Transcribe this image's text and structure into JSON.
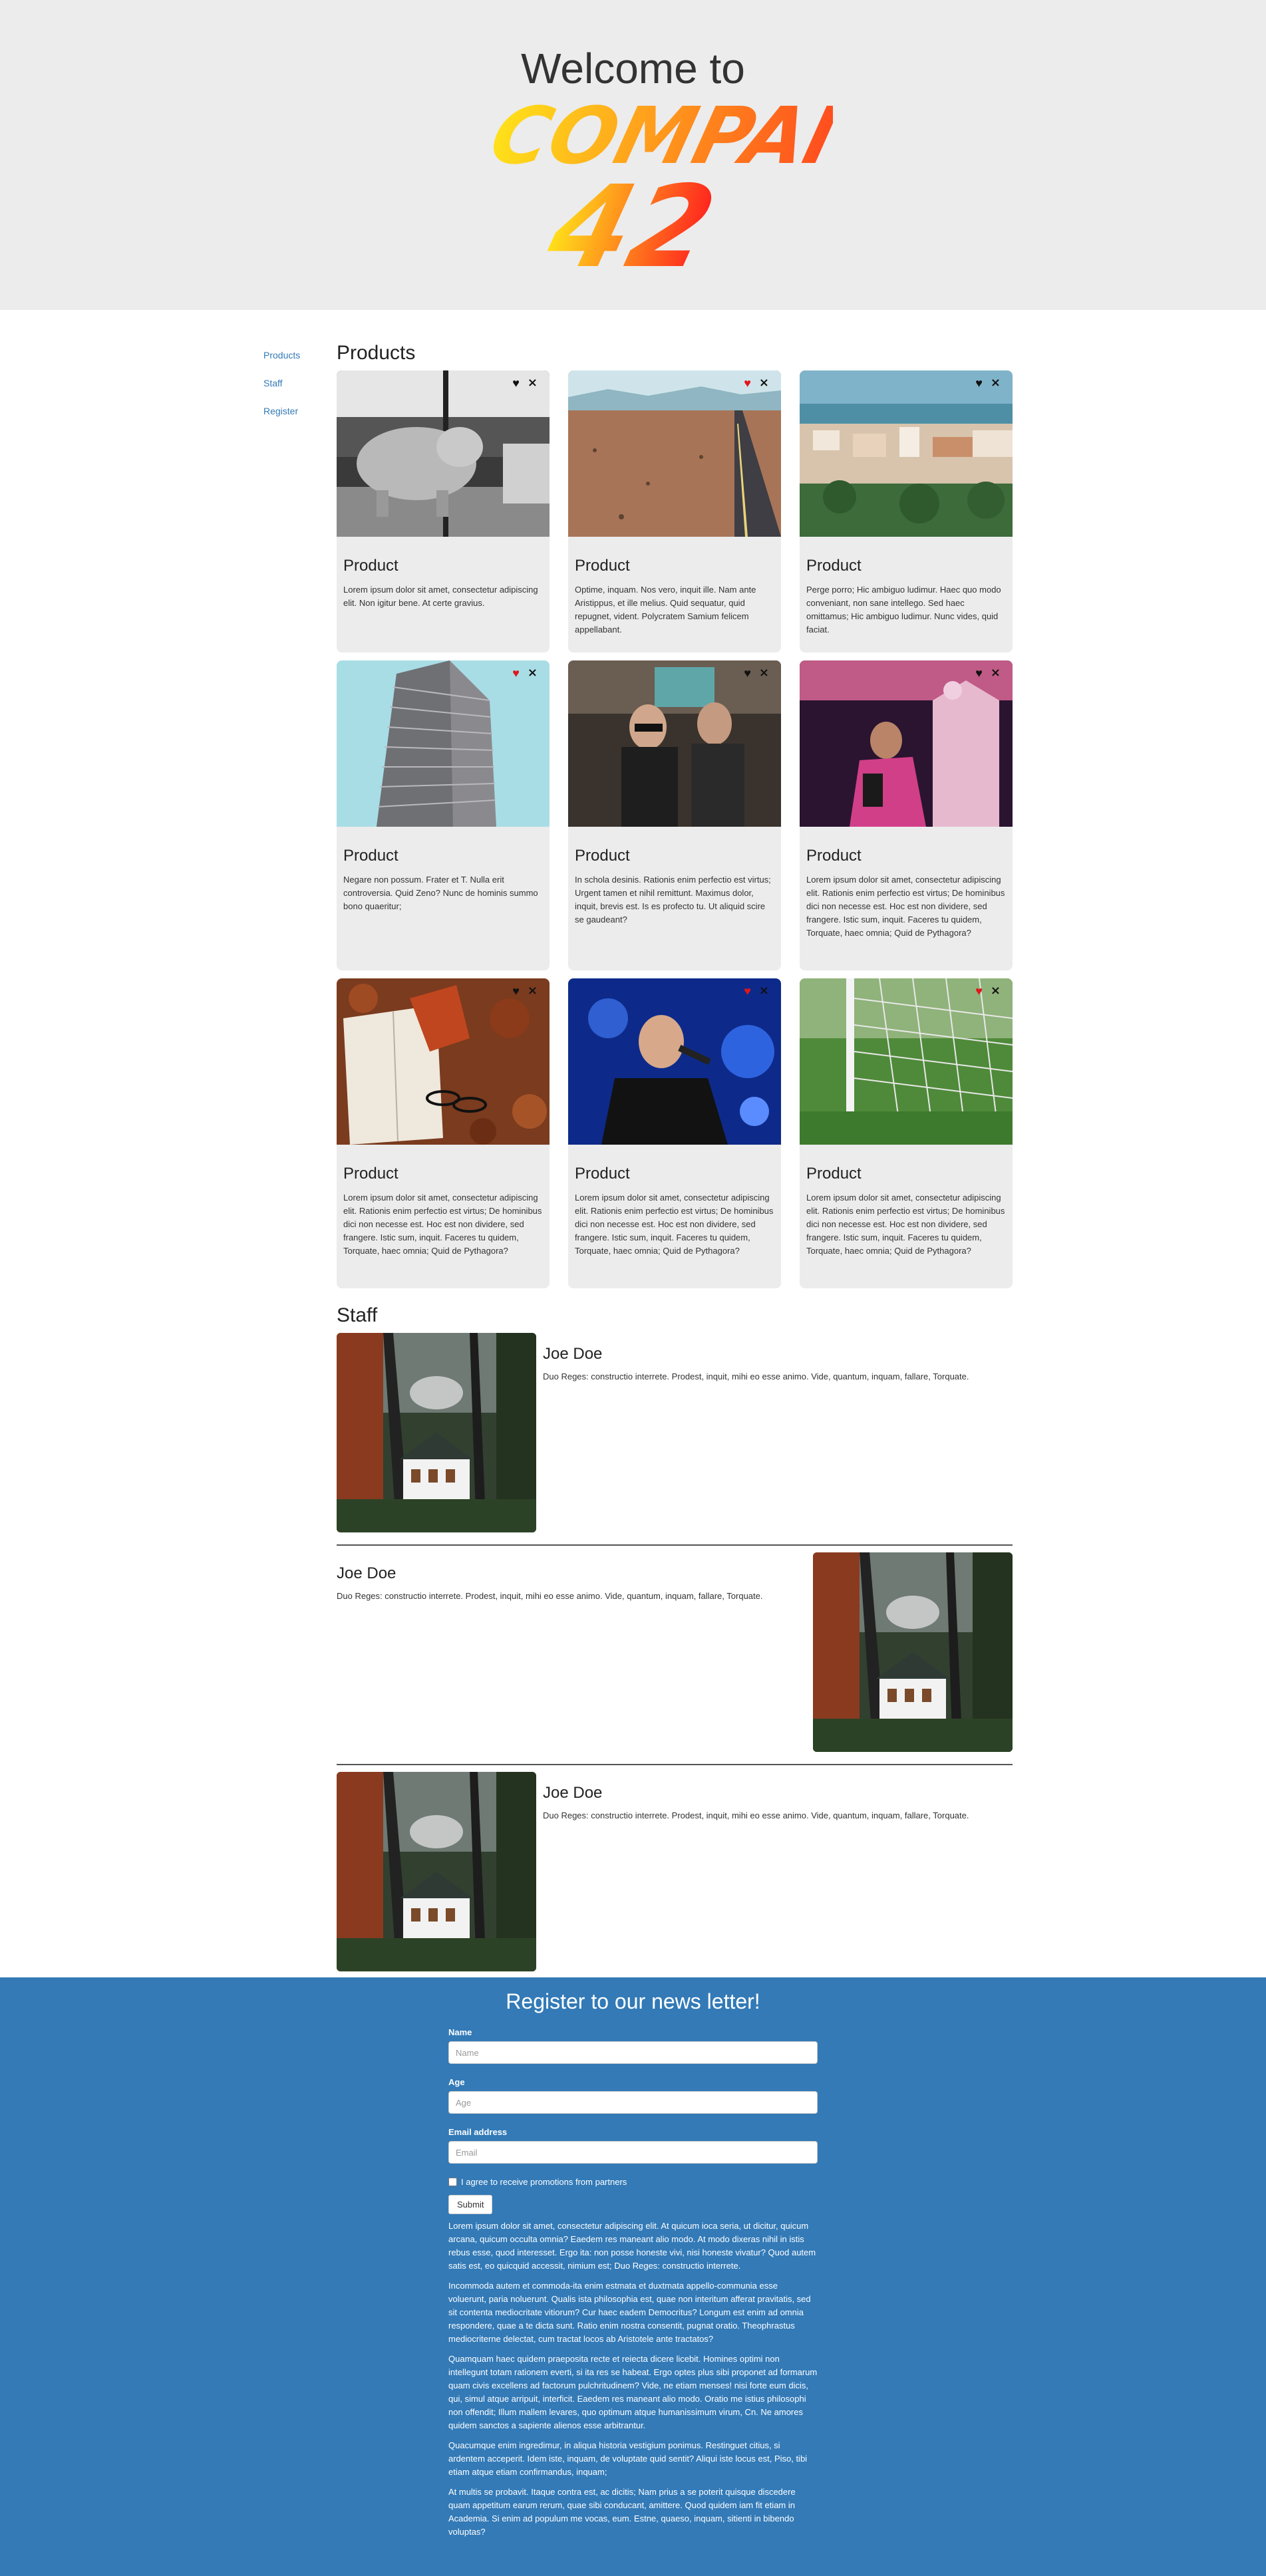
{
  "colors": {
    "accent": "#337ab7",
    "hero_bg": "#ececec",
    "card_bg": "#ececec",
    "heart_red": "#e0161b",
    "heart_black": "#111111",
    "logo_gradient_start": "#ffe21a",
    "logo_gradient_end": "#ff1f1f"
  },
  "hero": {
    "title": "Welcome to",
    "logo_line1": "COMPANY",
    "logo_line2": "42"
  },
  "sidenav": {
    "items": [
      {
        "label": "Products"
      },
      {
        "label": "Staff"
      },
      {
        "label": "Register"
      }
    ]
  },
  "products": {
    "title": "Products",
    "items": [
      {
        "title": "Product",
        "text": "Lorem ipsum dolor sit amet, consectetur adipiscing elit. Non igitur bene. At certe gravius.",
        "favorite": false,
        "image": "pig-sculpture-photo"
      },
      {
        "title": "Product",
        "text": "Optime, inquam. Nos vero, inquit ille. Nam ante Aristippus, et ille melius. Quid sequatur, quid repugnet, vident. Polycratem Samium felicem appellabant.",
        "favorite": true,
        "image": "desert-road-photo"
      },
      {
        "title": "Product",
        "text": "Perge porro; Hic ambiguo ludimur. Haec quo modo conveniant, non sane intellego. Sed haec omittamus; Hic ambiguo ludimur. Nunc vides, quid faciat.",
        "favorite": false,
        "image": "coastal-town-photo"
      },
      {
        "title": "Product",
        "text": "Negare non possum. Frater et T. Nulla erit controversia. Quid Zeno? Nunc de hominis summo bono quaeritur;",
        "favorite": true,
        "image": "skyscraper-photo"
      },
      {
        "title": "Product",
        "text": "In schola desinis. Rationis enim perfectio est virtus; Urgent tamen et nihil remittunt. Maximus dolor, inquit, brevis est. Is es profecto tu. Ut aliquid scire se gaudeant?",
        "favorite": false,
        "image": "band-photo"
      },
      {
        "title": "Product",
        "text": "Lorem ipsum dolor sit amet, consectetur adipiscing elit. Rationis enim perfectio est virtus; De hominibus dici non necesse est. Hoc est non dividere, sed frangere. Istic sum, inquit. Faceres tu quidem, Torquate, haec omnia; Quid de Pythagora?",
        "favorite": false,
        "image": "performer-pink-photo"
      },
      {
        "title": "Product",
        "text": "Lorem ipsum dolor sit amet, consectetur adipiscing elit. Rationis enim perfectio est virtus; De hominibus dici non necesse est. Hoc est non dividere, sed frangere. Istic sum, inquit. Faceres tu quidem, Torquate, haec omnia; Quid de Pythagora?",
        "favorite": false,
        "image": "book-leaves-photo"
      },
      {
        "title": "Product",
        "text": "Lorem ipsum dolor sit amet, consectetur adipiscing elit. Rationis enim perfectio est virtus; De hominibus dici non necesse est. Hoc est non dividere, sed frangere. Istic sum, inquit. Faceres tu quidem, Torquate, haec omnia; Quid de Pythagora?",
        "favorite": true,
        "image": "singer-blue-photo"
      },
      {
        "title": "Product",
        "text": "Lorem ipsum dolor sit amet, consectetur adipiscing elit. Rationis enim perfectio est virtus; De hominibus dici non necesse est. Hoc est non dividere, sed frangere. Istic sum, inquit. Faceres tu quidem, Torquate, haec omnia; Quid de Pythagora?",
        "favorite": true,
        "image": "soccer-goal-photo"
      }
    ],
    "close_glyph": "×",
    "heart_glyph": "♥"
  },
  "staff": {
    "title": "Staff",
    "members": [
      {
        "name": "Joe Doe",
        "bio": "Duo Reges: constructio interrete. Prodest, inquit, mihi eo esse animo. Vide, quantum, inquam, fallare, Torquate.",
        "photo": "house-in-forest-photo",
        "photo_side": "left"
      },
      {
        "name": "Joe Doe",
        "bio": "Duo Reges: constructio interrete. Prodest, inquit, mihi eo esse animo. Vide, quantum, inquam, fallare, Torquate.",
        "photo": "house-in-forest-photo",
        "photo_side": "right"
      },
      {
        "name": "Joe Doe",
        "bio": "Duo Reges: constructio interrete. Prodest, inquit, mihi eo esse animo. Vide, quantum, inquam, fallare, Torquate.",
        "photo": "house-in-forest-photo",
        "photo_side": "left"
      }
    ]
  },
  "newsletter": {
    "title": "Register to our news letter!",
    "name_label": "Name",
    "name_placeholder": "Name",
    "age_label": "Age",
    "age_placeholder": "Age",
    "email_label": "Email address",
    "email_placeholder": "Email",
    "checkbox_label": "I agree to receive promotions from partners",
    "submit_label": "Submit",
    "paragraphs": [
      "Lorem ipsum dolor sit amet, consectetur adipiscing elit. At quicum ioca seria, ut dicitur, quicum arcana, quicum occulta omnia? Eaedem res maneant alio modo. At modo dixeras nihil in istis rebus esse, quod interesset. Ergo ita: non posse honeste vivi, nisi honeste vivatur? Quod autem satis est, eo quicquid accessit, nimium est; Duo Reges: constructio interrete.",
      "Incommoda autem et commoda-ita enim estmata et duxtmata appello-communia esse voluerunt, paria noluerunt. Qualis ista philosophia est, quae non interitum afferat pravitatis, sed sit contenta mediocritate vitiorum? Cur haec eadem Democritus? Longum est enim ad omnia respondere, quae a te dicta sunt. Ratio enim nostra consentit, pugnat oratio. Theophrastus mediocriterne delectat, cum tractat locos ab Aristotele ante tractatos?",
      "Quamquam haec quidem praeposita recte et reiecta dicere licebit. Homines optimi non intellegunt totam rationem everti, si ita res se habeat. Ergo optes plus sibi proponet ad formarum quam civis excellens ad factorum pulchritudinem? Vide, ne etiam menses! nisi forte eum dicis, qui, simul atque arripuit, interficit. Eaedem res maneant alio modo. Oratio me istius philosophi non offendit; Illum mallem levares, quo optimum atque humanissimum virum, Cn. Ne amores quidem sanctos a sapiente alienos esse arbitrantur.",
      "Quacumque enim ingredimur, in aliqua historia vestigium ponimus. Restinguet citius, si ardentem acceperit. Idem iste, inquam, de voluptate quid sentit? Aliqui iste locus est, Piso, tibi etiam atque etiam confirmandus, inquam;",
      "At multis se probavit. Itaque contra est, ac dicitis; Nam prius a se poterit quisque discedere quam appetitum earum rerum, quae sibi conducant, amittere. Quod quidem iam fit etiam in Academia. Si enim ad populum me vocas, eum. Estne, quaeso, inquam, sitienti in bibendo voluptas?"
    ]
  }
}
